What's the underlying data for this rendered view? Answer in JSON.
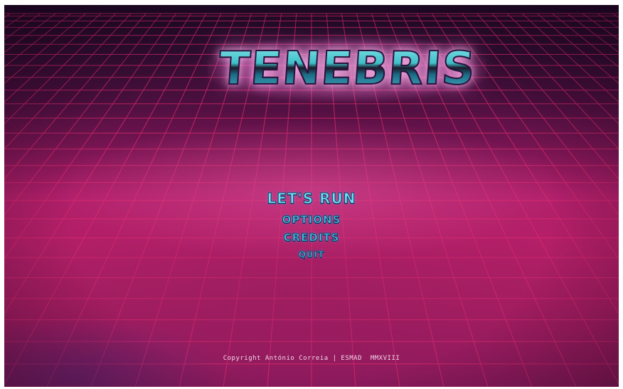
{
  "game": {
    "title": "TENEBRIS",
    "menu": {
      "primary_label": "LET'S RUN",
      "options_label": "OPTIONS",
      "credits_label": "CREDITS",
      "quit_label": "QUIT"
    },
    "copyright": "Copyright António Correia | ESMAD  MMXVIII"
  },
  "colors": {
    "grid_line": "#e02a6e",
    "menu_text": "#4cc4e6",
    "background_magenta": "#b11f6a",
    "sky_dark": "#1c0a24"
  }
}
